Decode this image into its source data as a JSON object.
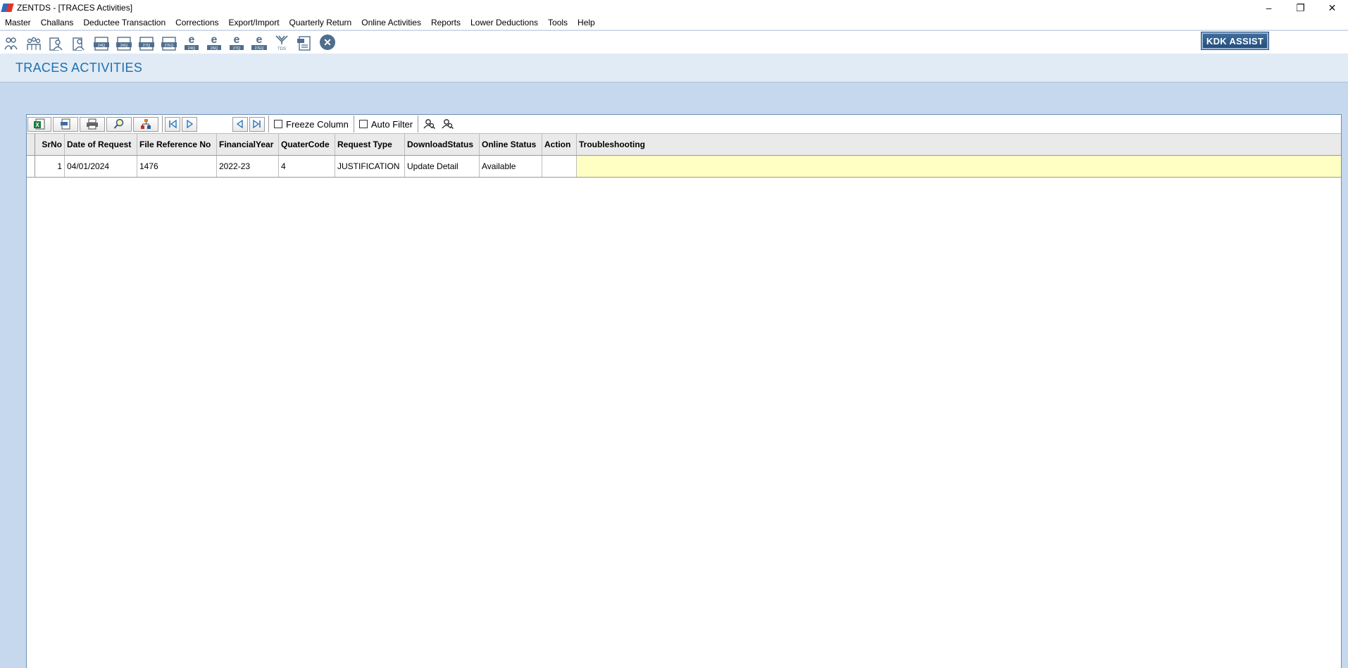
{
  "window": {
    "title": "ZENTDS - [TRACES Activities]",
    "controls": [
      "–",
      "❐",
      "✕"
    ]
  },
  "menu": [
    "Master",
    "Challans",
    "Deductee Transaction",
    "Corrections",
    "Export/Import",
    "Quarterly Return",
    "Online Activities",
    "Reports",
    "Lower Deductions",
    "Tools",
    "Help"
  ],
  "toolbar": {
    "icons": [
      {
        "name": "deductor-icon",
        "label": ""
      },
      {
        "name": "deductees-icon",
        "label": ""
      },
      {
        "name": "employee-icon",
        "label": ""
      },
      {
        "name": "person-icon",
        "label": ""
      },
      {
        "name": "form-24q-icon",
        "label": "24Q"
      },
      {
        "name": "form-26q-icon",
        "label": "26Q"
      },
      {
        "name": "form-27q-icon",
        "label": "27Q"
      },
      {
        "name": "form-27eq-icon",
        "label": "27EQ"
      },
      {
        "name": "e-24q-icon",
        "label": "24Q"
      },
      {
        "name": "e-26q-icon",
        "label": "26Q"
      },
      {
        "name": "e-27q-icon",
        "label": "27Q"
      },
      {
        "name": "e-27eq-icon",
        "label": "27EQ"
      },
      {
        "name": "tds-icon",
        "label": "TDS"
      },
      {
        "name": "document-icon",
        "label": ""
      }
    ],
    "kdk_assist": "KDK ASSIST"
  },
  "page": {
    "title": "TRACES ACTIVITIES"
  },
  "grid_toolbar": {
    "freeze_column": "Freeze Column",
    "auto_filter": "Auto Filter"
  },
  "grid": {
    "columns": [
      "SrNo",
      "Date of Request",
      "File Reference No",
      "FinancialYear",
      "QuaterCode",
      "Request Type",
      "DownloadStatus",
      "Online Status",
      "Action",
      "Troubleshooting"
    ],
    "rows": [
      [
        "1",
        "04/01/2024",
        "1476",
        "2022-23",
        "4",
        "JUSTIFICATION",
        "Update Detail",
        "Available",
        "",
        ""
      ]
    ]
  },
  "colors": {
    "background": "#c6d8ee",
    "title_color": "#1f6fad",
    "highlight_cell": "#ffffc4"
  }
}
